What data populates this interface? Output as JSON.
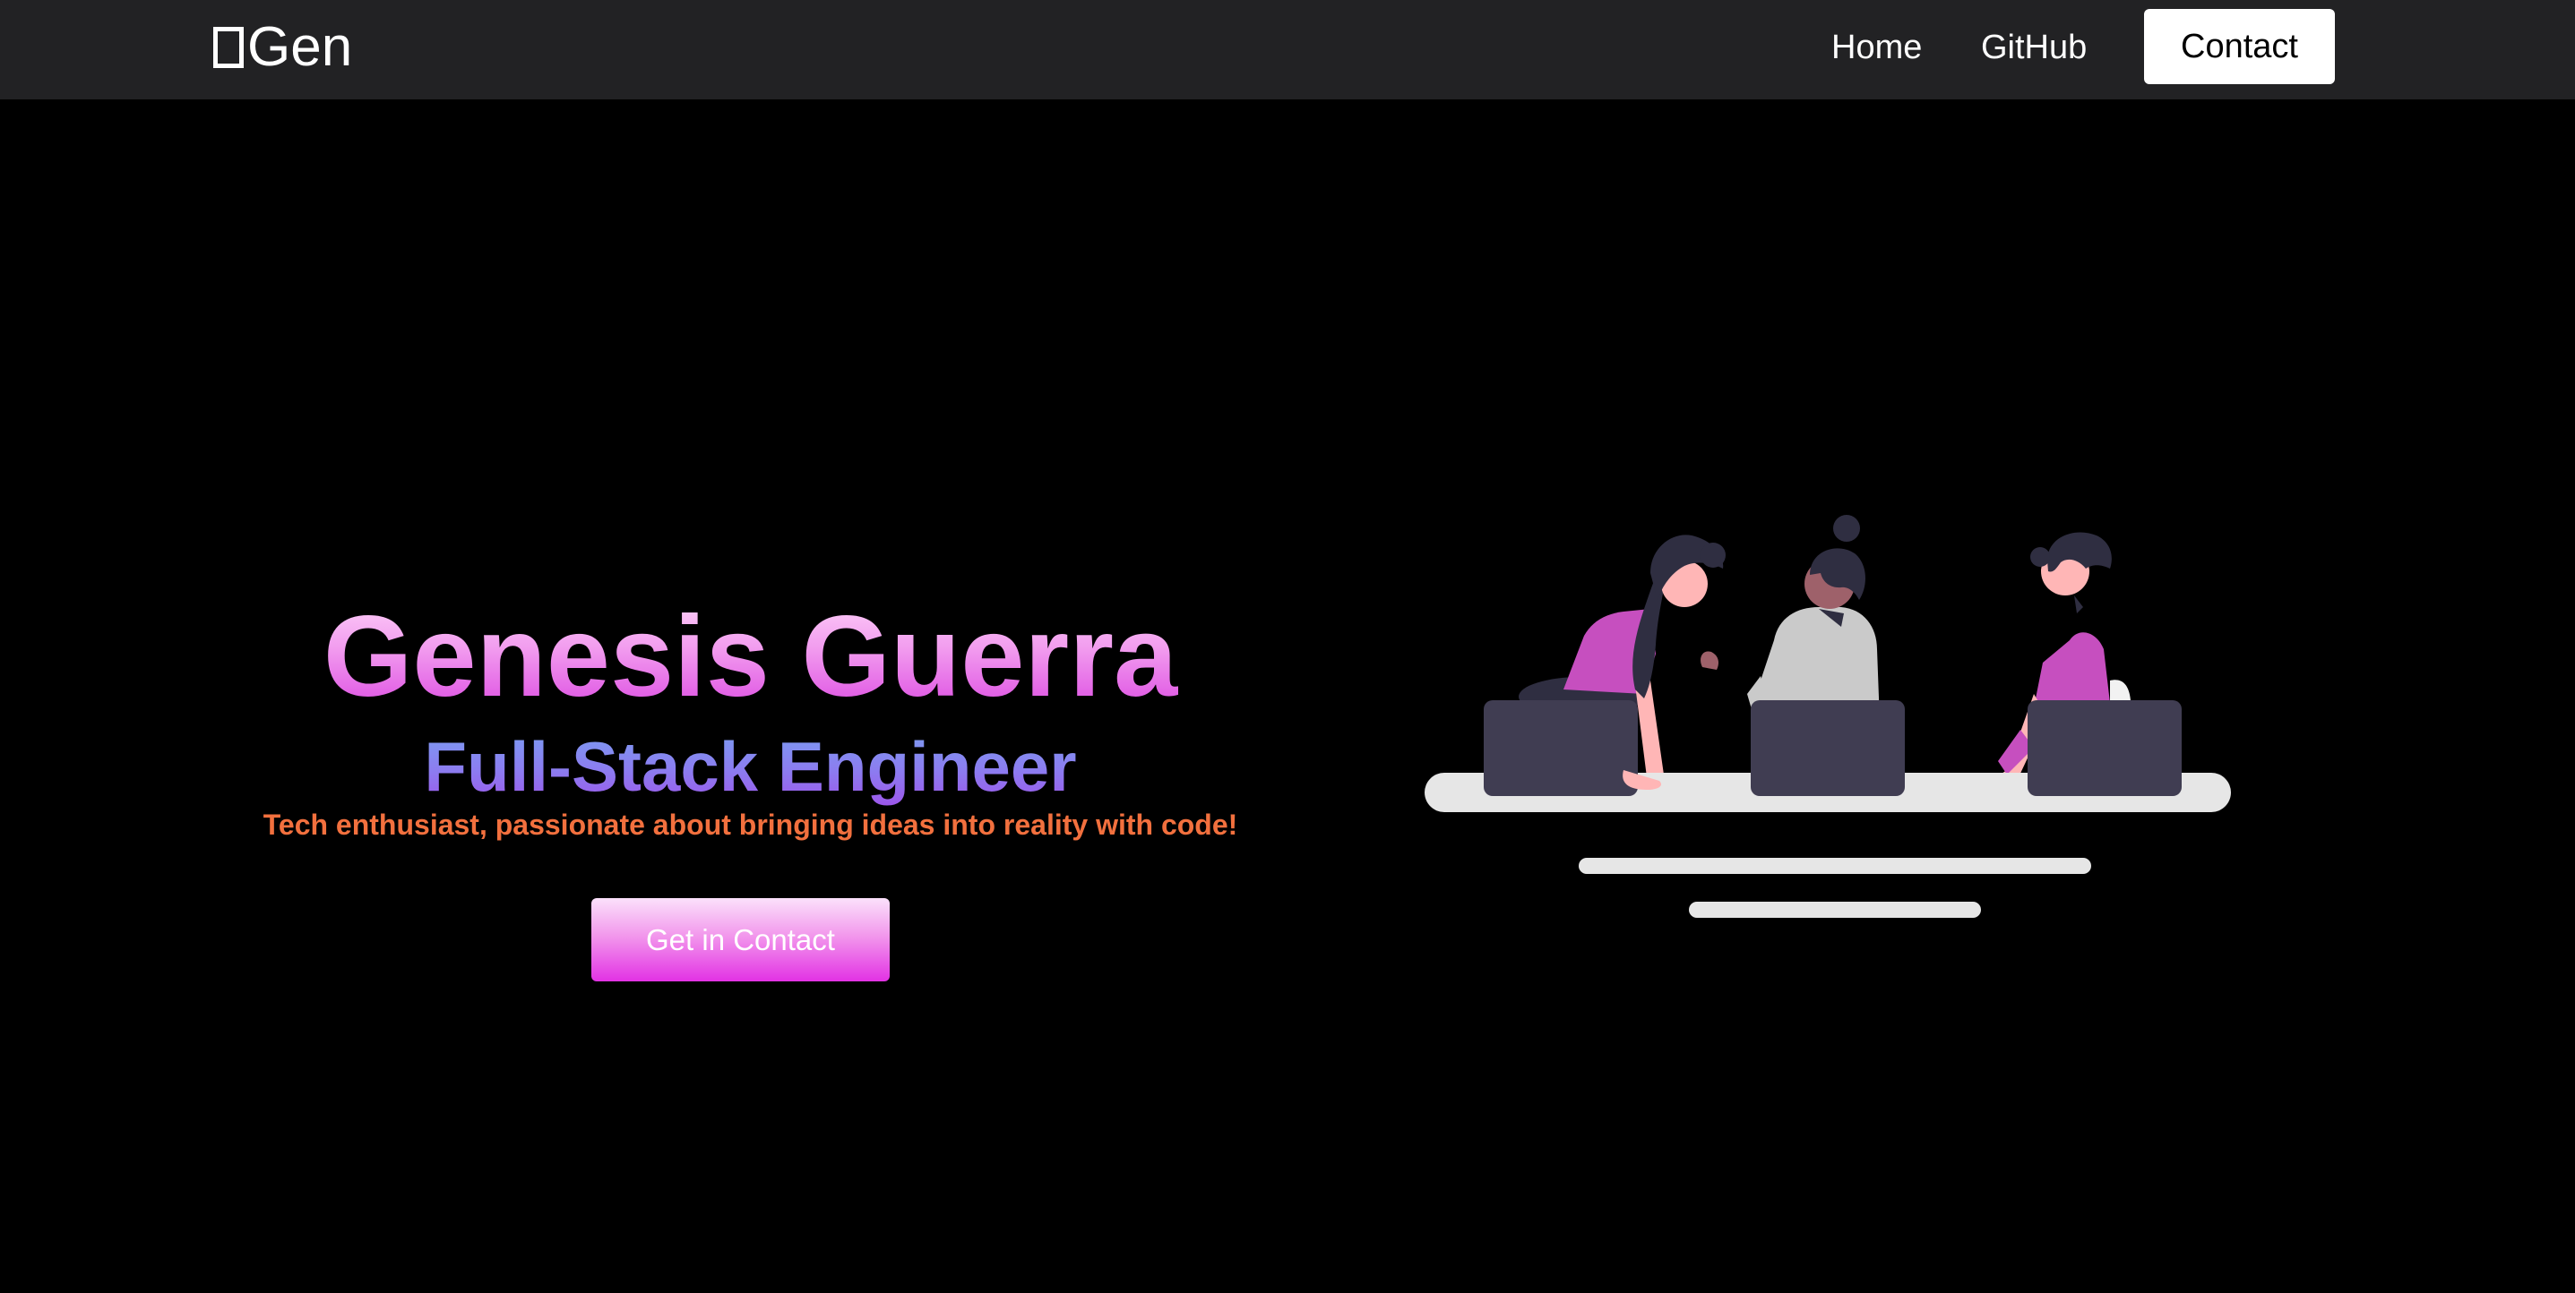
{
  "nav": {
    "brand": "Gen",
    "brand_icon": "square-outline-icon",
    "links": [
      {
        "label": "Home"
      },
      {
        "label": "GitHub"
      }
    ],
    "contact_label": "Contact"
  },
  "hero": {
    "name": "Genesis Guerra",
    "role": "Full-Stack Engineer",
    "tagline": "Tech enthusiast, passionate about bringing ideas into reality with code!",
    "cta_label": "Get in Contact"
  },
  "illustration": {
    "name": "team-working-at-laptops-illustration"
  },
  "colors": {
    "page_bg": "#000000",
    "navbar_bg": "#222224",
    "name_gradient": [
      "#ffd8fa",
      "#d93fe0"
    ],
    "role_gradient": [
      "#7aa0f2",
      "#9d55ea"
    ],
    "tagline": "#f2703e",
    "cta_gradient": [
      "#fbe1fb",
      "#e232e4"
    ],
    "accent_purple": "#c64fbf",
    "laptop": "#403d52",
    "table": "#e6e6e6"
  }
}
